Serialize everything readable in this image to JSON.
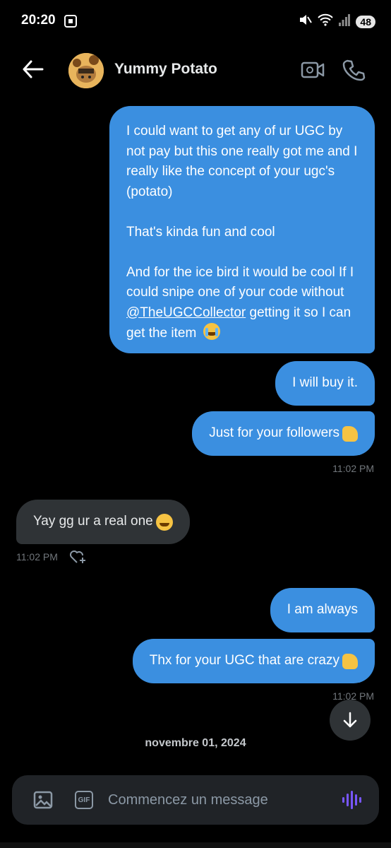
{
  "status_bar": {
    "time": "20:20",
    "battery": "48",
    "icons": [
      "screen-record-icon",
      "mute-icon",
      "wifi-icon",
      "signal-icon",
      "battery-icon"
    ]
  },
  "header": {
    "contact_name": "Yummy Potato",
    "icons": [
      "back-arrow-icon",
      "avatar",
      "video-call-icon",
      "phone-icon"
    ]
  },
  "messages": [
    {
      "direction": "sent",
      "paragraphs": [
        "I could want to get any of ur UGC by not pay but this one really got me and I really like the concept of your ugc's (potato)",
        "That's kinda fun and cool",
        "And for the ice bird it would be cool If I could snipe one of your code without "
      ],
      "mention": "@TheUGCCollector",
      "after_mention": " getting it so I can get the item",
      "emoji": "loudly-crying-face"
    },
    {
      "direction": "sent",
      "text": "I will buy it."
    },
    {
      "direction": "sent",
      "text": "Just for your followers",
      "emoji": "thumbs-up",
      "time": "11:02 PM"
    },
    {
      "direction": "received",
      "text": "Yay gg ur a real one",
      "emoji": "grinning-face",
      "time": "11:02 PM"
    },
    {
      "direction": "sent",
      "text": "I am always"
    },
    {
      "direction": "sent",
      "text": "Thx for your UGC that are crazy",
      "emoji": "thumbs-up",
      "time": "11:02 PM"
    }
  ],
  "date_separator": "novembre 01, 2024",
  "composer": {
    "placeholder": "Commencez un message",
    "gif_label": "GIF"
  },
  "colors": {
    "background": "#000000",
    "sent_bubble": "#3b8fe0",
    "received_bubble": "#2f3336",
    "composer": "#202327",
    "voice_accent": "#7856ff"
  }
}
